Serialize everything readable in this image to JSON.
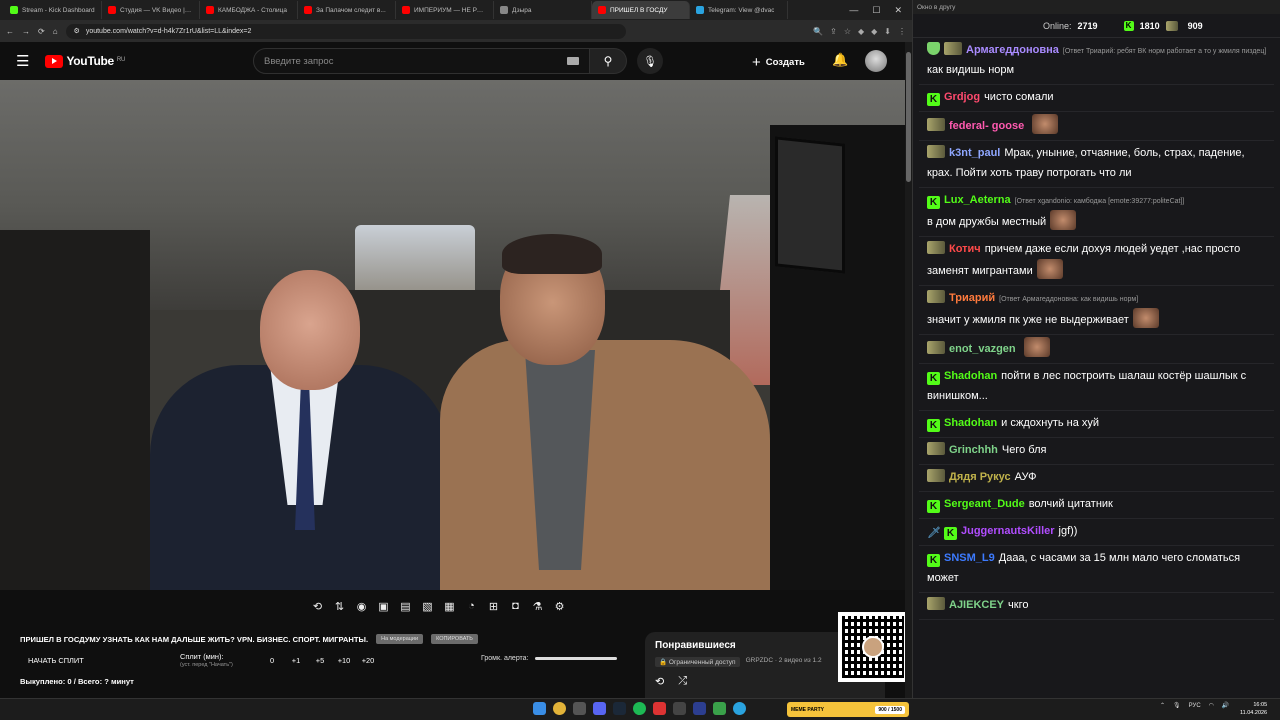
{
  "browser": {
    "tabs": [
      {
        "title": "Stream - Kick Dashboard",
        "color": "#53fc18"
      },
      {
        "title": "Студия — VK Видео | Главная",
        "color": "#ff0000"
      },
      {
        "title": "КАМБОДЖА - Столица",
        "color": "#ff0000"
      },
      {
        "title": "За Палачом следит в...",
        "color": "#ff0000"
      },
      {
        "title": "ИМПЕРИУМ — НЕ РО...",
        "color": "#ff0000"
      },
      {
        "title": "Дзыра",
        "color": "#888888"
      },
      {
        "title": "ПРИШЕЛ В ГОСДУ",
        "color": "#ff0000"
      },
      {
        "title": "Telegram: View @dvac",
        "color": "#2aa3df"
      }
    ],
    "url": "youtube.com/watch?v=d-h4k7Zr1rU&list=LL&index=2"
  },
  "youtube": {
    "logo": "YouTube",
    "region": "RU",
    "search_placeholder": "Введите запрос",
    "create_label": "Создать"
  },
  "video": {
    "title": "ПРИШЕЛ В ГОСДУМУ УЗНАТЬ КАК НАМ ДАЛЬШЕ ЖИТЬ? VPN. БИЗНЕС. СПОРТ. МИГРАНТЫ.",
    "pill1": "На модерации",
    "pill2": "КОПИРОВАТЬ"
  },
  "split": {
    "start_label": "НАЧАТЬ СПЛИТ",
    "minutes_label": "Сплит (мин):",
    "minutes_hint": "(уст. перед \"Начать\")",
    "nums": [
      "0",
      "+1",
      "+5",
      "+10",
      "+20"
    ],
    "alert_label": "Громк. алерта:",
    "bought": "Выкуплено: 0 / Всего: ? минут"
  },
  "liked": {
    "title": "Понравившиеся",
    "access": "Ограниченный доступ",
    "meta": "GRPZDC · 2 видео из 1.2"
  },
  "chat": {
    "window_title": "Окно в другу",
    "online_label": "Online:",
    "online_value": "2719",
    "kick_count": "1810",
    "twitch_count": "909",
    "messages": [
      {
        "badge": "sh",
        "user": "Армагеддоновна",
        "color": "#a98bff",
        "reply": "[Ответ Триарий: ребят ВК норм работает а то у жмиля пиздец]",
        "text": "как видишь норм",
        "emote": false
      },
      {
        "badge": "k",
        "user": "Grdjog",
        "color": "#ff4a6e",
        "reply": "",
        "text": "чисто сомали",
        "emote": false
      },
      {
        "badge": "tw",
        "user": "federal- goose",
        "color": "#ff5ab0",
        "reply": "",
        "text": "",
        "emote": true
      },
      {
        "badge": "tw",
        "user": "k3nt_paul",
        "color": "#8fa7ff",
        "reply": "",
        "text": "Мрак, уныние, отчаяние, боль, страх, падение, крах. Пойти хоть траву потрогать что ли",
        "emote": false
      },
      {
        "badge": "k",
        "user": "Lux_Aeterna",
        "color": "#53fc18",
        "reply": "[Ответ xgandonio: камбоджа [emote:39277:politeCat]]",
        "text": "в дом дружбы местный",
        "emote": true
      },
      {
        "badge": "tw",
        "user": "Котич",
        "color": "#ff4a4a",
        "reply": "",
        "text": "причем даже если дохуя людей уедет ,нас просто заменят мигрантами",
        "emote": true
      },
      {
        "badge": "tw",
        "user": "Триарий",
        "color": "#ff7a3d",
        "reply": "[Ответ Армагеддоновна: как видишь норм]",
        "text": "значит у жмиля пк уже не выдерживает",
        "emote": true
      },
      {
        "badge": "tw",
        "user": "enot_vazgen",
        "color": "#7fd38a",
        "reply": "",
        "text": "",
        "emote": true
      },
      {
        "badge": "k",
        "user": "Shadohan",
        "color": "#53fc18",
        "reply": "",
        "text": "пойти в лес построить шалаш костёр шашлык с винишком...",
        "emote": false
      },
      {
        "badge": "k",
        "user": "Shadohan",
        "color": "#53fc18",
        "reply": "",
        "text": "и сждохнуть на хуй",
        "emote": false
      },
      {
        "badge": "tw",
        "user": "Grinchhh",
        "color": "#7fd38a",
        "reply": "",
        "text": "Чего бля",
        "emote": false
      },
      {
        "badge": "tw",
        "user": "Дядя Рукус",
        "color": "#c0b24b",
        "reply": "",
        "text": "АУФ",
        "emote": false
      },
      {
        "badge": "k",
        "user": "Sergeant_Dude",
        "color": "#53fc18",
        "reply": "",
        "text": "волчий цитатник",
        "emote": false
      },
      {
        "badge": "swk",
        "user": "JuggernautsKiller",
        "color": "#b14dff",
        "reply": "",
        "text": "jgf))",
        "emote": false
      },
      {
        "badge": "k",
        "user": "SNSM_L9",
        "color": "#3d7bff",
        "reply": "",
        "text": "Дааа, с часами за 15 млн мало чего сломаться может",
        "emote": false
      },
      {
        "badge": "tw",
        "user": "AJIEKCEY",
        "color": "#7fd38a",
        "reply": "",
        "text": "чкго",
        "emote": false
      }
    ]
  },
  "taskbar": {
    "meme_label": "MEME PARTY",
    "meme_value": "900 / 1500",
    "lang": "РУС",
    "time": "16:05",
    "date": "11.04.2026"
  }
}
